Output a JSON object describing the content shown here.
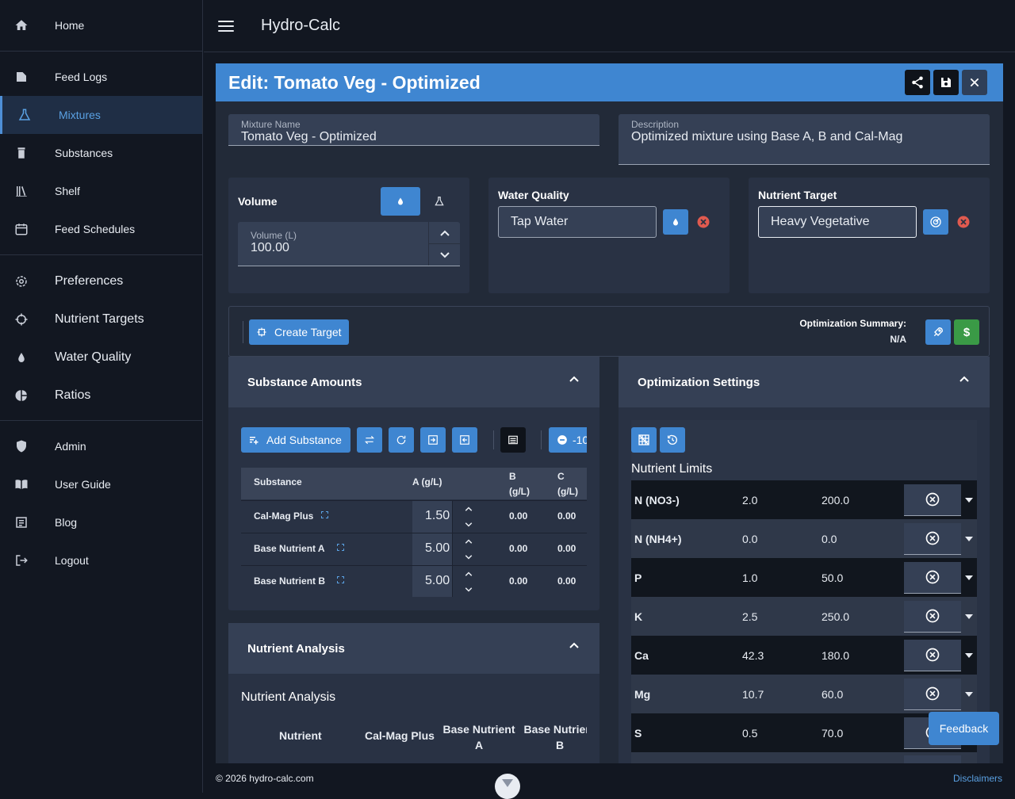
{
  "app": {
    "title": "Hydro-Calc"
  },
  "sidebar": {
    "groups": [
      [
        {
          "label": "Home",
          "icon": "home-icon"
        }
      ],
      [
        {
          "label": "Feed Logs",
          "icon": "feed-logs-icon"
        },
        {
          "label": "Mixtures",
          "icon": "flask-icon",
          "active": true
        },
        {
          "label": "Substances",
          "icon": "substance-icon"
        },
        {
          "label": "Shelf",
          "icon": "shelf-icon"
        },
        {
          "label": "Feed Schedules",
          "icon": "calendar-icon"
        }
      ],
      [
        {
          "label": "Preferences",
          "icon": "gear-icon"
        },
        {
          "label": "Nutrient Targets",
          "icon": "crosshair-icon"
        },
        {
          "label": "Water Quality",
          "icon": "water-drop-icon"
        },
        {
          "label": "Ratios",
          "icon": "pie-chart-icon"
        }
      ],
      [
        {
          "label": "Admin",
          "icon": "shield-icon"
        },
        {
          "label": "User Guide",
          "icon": "book-icon"
        },
        {
          "label": "Blog",
          "icon": "blog-icon"
        },
        {
          "label": "Logout",
          "icon": "logout-icon"
        }
      ]
    ]
  },
  "editor": {
    "title": "Edit: Tomato Veg - Optimized",
    "mixture_name_label": "Mixture Name",
    "mixture_name_value": "Tomato Veg - Optimized",
    "description_label": "Description",
    "description_value": "Optimized mixture using Base A, B and Cal-Mag"
  },
  "volume": {
    "title": "Volume",
    "field_label": "Volume (L)",
    "value": "100.00"
  },
  "water_quality": {
    "title": "Water Quality",
    "value": "Tap Water"
  },
  "nutrient_target": {
    "title": "Nutrient Target",
    "value": "Heavy Vegetative"
  },
  "toolbar": {
    "create_target": "Create Target",
    "summary_label": "Optimization Summary:",
    "summary_value": "N/A"
  },
  "substances": {
    "section_title": "Substance Amounts",
    "add_button": "Add Substance",
    "decrement_label": "-10",
    "columns": [
      "Substance",
      "A (g/L)",
      "B (g/L)",
      "C (g/L)"
    ],
    "rows": [
      {
        "name": "Cal-Mag Plus",
        "a": "1.50",
        "b": "0.00",
        "c": "0.00"
      },
      {
        "name": "Base Nutrient A",
        "a": "5.00",
        "b": "0.00",
        "c": "0.00"
      },
      {
        "name": "Base Nutrient B",
        "a": "5.00",
        "b": "0.00",
        "c": "0.00"
      }
    ]
  },
  "analysis": {
    "section_title": "Nutrient Analysis",
    "heading": "Nutrient Analysis",
    "columns": [
      "Nutrient",
      "Cal-Mag Plus",
      "Base Nutrient A",
      "Base Nutrient B"
    ]
  },
  "optimization": {
    "section_title": "Optimization Settings",
    "limits_title": "Nutrient Limits",
    "limits": [
      {
        "name": "N (NO3-)",
        "min": "2.0",
        "max": "200.0"
      },
      {
        "name": "N (NH4+)",
        "min": "0.0",
        "max": "0.0"
      },
      {
        "name": "P",
        "min": "1.0",
        "max": "50.0"
      },
      {
        "name": "K",
        "min": "2.5",
        "max": "250.0"
      },
      {
        "name": "Ca",
        "min": "42.3",
        "max": "180.0"
      },
      {
        "name": "Mg",
        "min": "10.7",
        "max": "60.0"
      },
      {
        "name": "S",
        "min": "0.5",
        "max": "70.0"
      }
    ]
  },
  "feedback": {
    "label": "Feedback"
  },
  "footer": {
    "copyright": "© 2026 hydro-calc.com",
    "disclaimers": "Disclaimers"
  },
  "colors": {
    "accent": "#3f86d1",
    "success": "#3a9a46",
    "danger": "#e05a4f"
  }
}
